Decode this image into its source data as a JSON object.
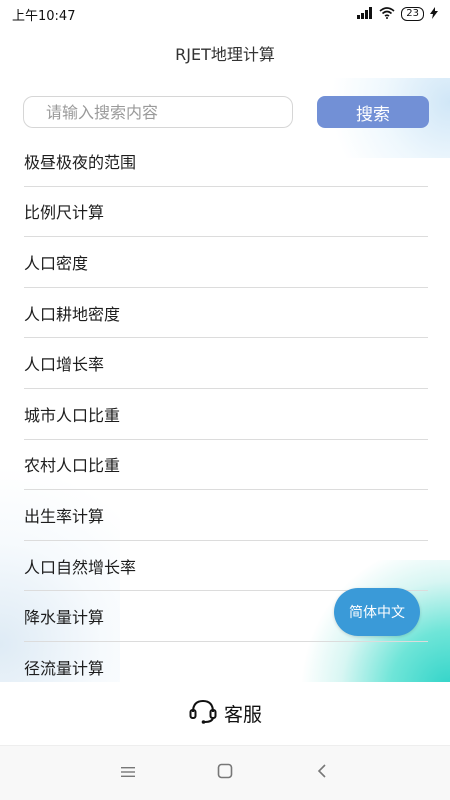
{
  "status_bar": {
    "time": "上午10:47",
    "battery": "23"
  },
  "header": {
    "title": "RJET地理计算"
  },
  "search": {
    "placeholder": "请输入搜索内容",
    "button_label": "搜索"
  },
  "list": {
    "items": [
      {
        "label": "极昼极夜的范围"
      },
      {
        "label": "比例尺计算"
      },
      {
        "label": "人口密度"
      },
      {
        "label": "人口耕地密度"
      },
      {
        "label": "人口增长率"
      },
      {
        "label": "城市人口比重"
      },
      {
        "label": "农村人口比重"
      },
      {
        "label": "出生率计算"
      },
      {
        "label": "人口自然增长率"
      },
      {
        "label": "降水量计算"
      },
      {
        "label": "径流量计算"
      }
    ]
  },
  "language_button": {
    "label": "简体中文"
  },
  "bottom_bar": {
    "service_label": "客服"
  },
  "colors": {
    "accent": "#7290d6",
    "language_button": "#3a9ad8"
  }
}
